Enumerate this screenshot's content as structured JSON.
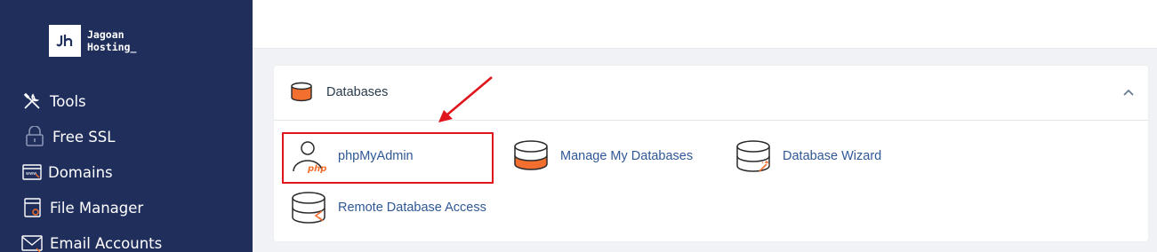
{
  "brand": {
    "line1": "Jagoan",
    "line2": "Hosting_"
  },
  "sidebar": {
    "items": [
      {
        "label": "Tools",
        "icon": "tools-icon"
      },
      {
        "label": "Free SSL",
        "icon": "lock-icon"
      },
      {
        "label": "Domains",
        "icon": "domain-icon"
      },
      {
        "label": "File Manager",
        "icon": "file-manager-icon"
      },
      {
        "label": "Email Accounts",
        "icon": "email-icon"
      }
    ]
  },
  "panel": {
    "title": "Databases",
    "tools": [
      {
        "label": "phpMyAdmin",
        "icon": "phpmyadmin-icon"
      },
      {
        "label": "Manage My Databases",
        "icon": "manage-databases-icon"
      },
      {
        "label": "Database Wizard",
        "icon": "database-wizard-icon"
      },
      {
        "label": "Remote Database Access",
        "icon": "remote-database-icon"
      }
    ]
  },
  "colors": {
    "sidebar_bg": "#202e5c",
    "link": "#2f5896",
    "accent_orange": "#f26f2f",
    "highlight_red": "#e0151c"
  }
}
